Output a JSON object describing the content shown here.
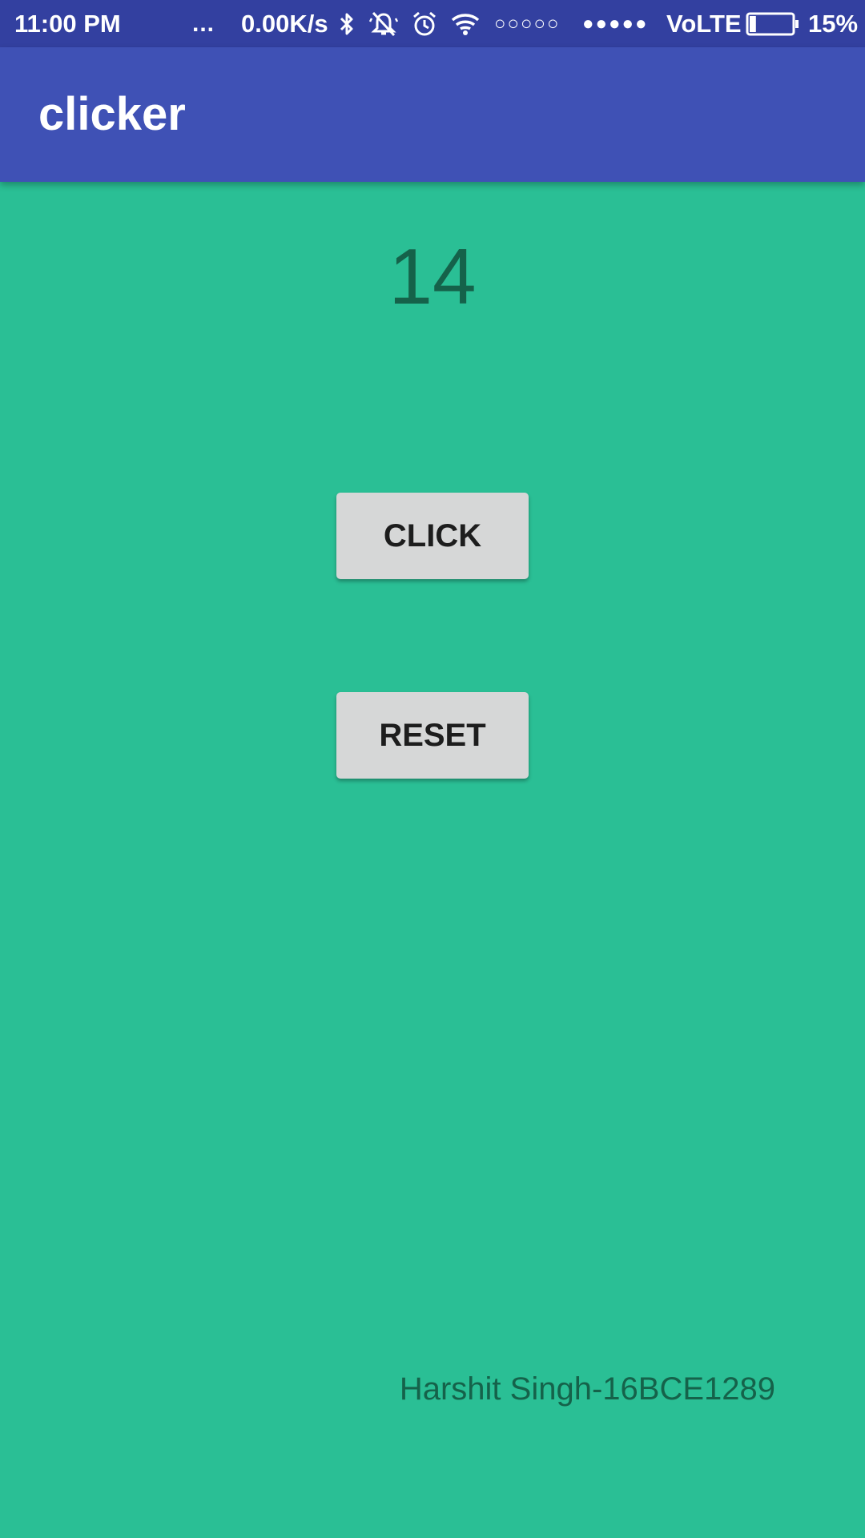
{
  "status_bar": {
    "time": "11:00 PM",
    "more_indicator": "...",
    "net_speed": "0.00K/s",
    "icons": [
      "bluetooth-icon",
      "vibrate-off-icon",
      "alarm-icon",
      "wifi-icon",
      "battery-icon"
    ],
    "sim1_signal": "○○○○○",
    "sim2_signal": "●●●●●",
    "network_type": "VoLTE",
    "battery_level": 0.15,
    "battery_text": "15%"
  },
  "app_bar": {
    "title": "clicker",
    "color": "#3F51B5",
    "status_color": "#3340A0"
  },
  "main": {
    "background_color": "#2ABF95",
    "counter_value": "14",
    "click_button_label": "CLICK",
    "reset_button_label": "RESET",
    "footer_text": "Harshit Singh-16BCE1289"
  }
}
